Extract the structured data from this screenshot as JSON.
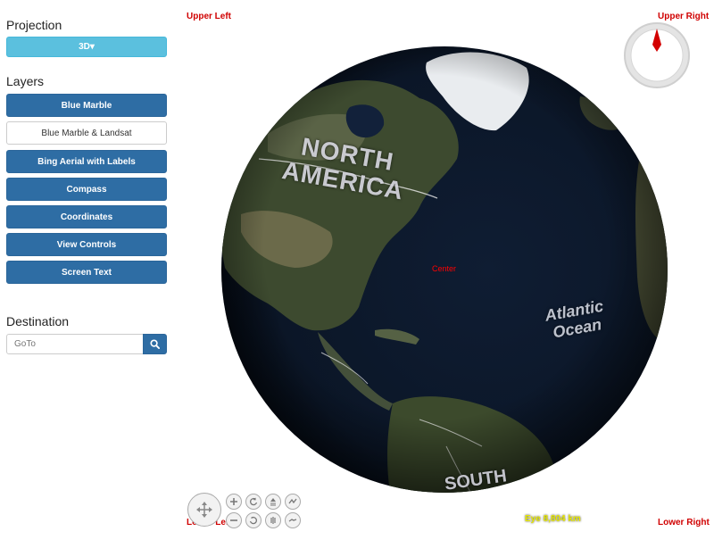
{
  "sidebar": {
    "projection_title": "Projection",
    "projection_button": "3D▾",
    "layers_title": "Layers",
    "layers": [
      {
        "label": "Blue Marble",
        "active": true
      },
      {
        "label": "Blue Marble & Landsat",
        "active": false
      },
      {
        "label": "Bing Aerial with Labels",
        "active": true
      },
      {
        "label": "Compass",
        "active": true
      },
      {
        "label": "Coordinates",
        "active": true
      },
      {
        "label": "View Controls",
        "active": true
      },
      {
        "label": "Screen Text",
        "active": true
      }
    ],
    "destination_title": "Destination",
    "goto_placeholder": "GoTo",
    "goto_button_icon": "search-icon"
  },
  "globe": {
    "labels": {
      "north_america_line1": "NORTH",
      "north_america_line2": "AMERICA",
      "atlantic_line1": "Atlantic",
      "atlantic_line2": "Ocean",
      "south": "SOUTH"
    },
    "screen_text": {
      "upper_left": "Upper Left",
      "upper_right": "Upper Right",
      "lower_left": "Lower Left",
      "lower_right": "Lower Right",
      "center": "Center"
    },
    "eye_text": "Eye  8,804 km"
  },
  "colors": {
    "primary": "#2e6da4",
    "info": "#5bc0de",
    "screen_text": "#d00000",
    "eye_text": "#e8e800",
    "ocean": "#0e1a2c"
  },
  "view_controls": [
    "pan-icon",
    "zoom-in-icon",
    "zoom-out-icon",
    "heading-left-icon",
    "heading-right-icon",
    "tilt-up-icon",
    "tilt-down-icon",
    "exaggeration-up-icon",
    "exaggeration-down-icon"
  ]
}
